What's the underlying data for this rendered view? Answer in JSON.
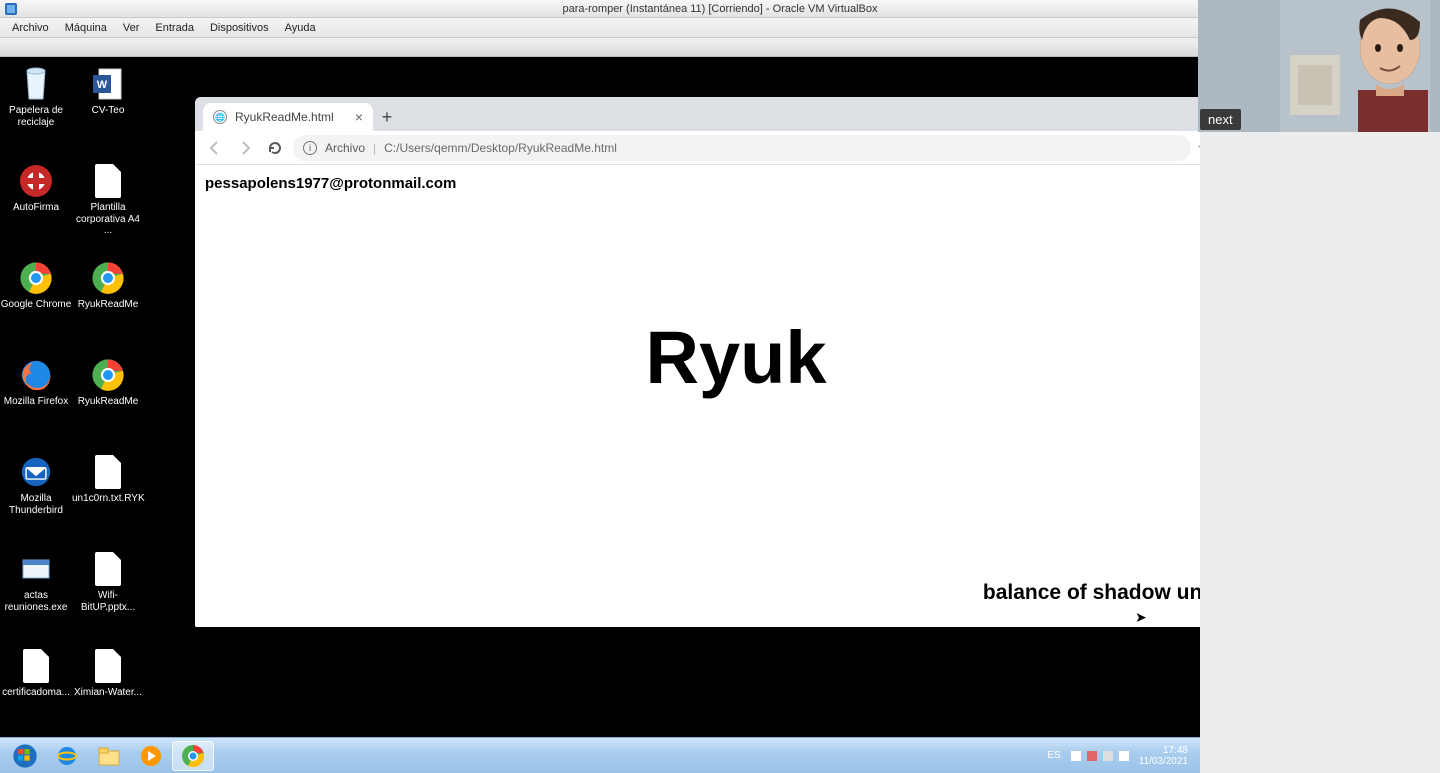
{
  "host_window": {
    "title": "para-romper (Instantánea 11) [Corriendo] - Oracle VM VirtualBox",
    "menu": [
      "Archivo",
      "Máquina",
      "Ver",
      "Entrada",
      "Dispositivos",
      "Ayuda"
    ]
  },
  "desktop_icons": {
    "col1": [
      {
        "name": "recycle-bin",
        "label": "Papelera de reciclaje"
      },
      {
        "name": "autofirma",
        "label": "AutoFirma"
      },
      {
        "name": "google-chrome",
        "label": "Google Chrome"
      },
      {
        "name": "mozilla-firefox",
        "label": "Mozilla Firefox"
      },
      {
        "name": "mozilla-thunderbird",
        "label": "Mozilla Thunderbird"
      },
      {
        "name": "actas-reuniones",
        "label": "actas reuniones.exe"
      },
      {
        "name": "certificadoma",
        "label": "certificadoma..."
      }
    ],
    "col2": [
      {
        "name": "cv-teo",
        "label": "CV-Teo"
      },
      {
        "name": "plantilla-corporativa",
        "label": "Plantilla corporativa A4 ..."
      },
      {
        "name": "ryukreadme-1",
        "label": "RyukReadMe"
      },
      {
        "name": "ryukreadme-2",
        "label": "RyukReadMe"
      },
      {
        "name": "un1c0rn",
        "label": "un1c0rn.txt.RYK"
      },
      {
        "name": "wifi-bitup",
        "label": "Wifi-BitUP.pptx..."
      },
      {
        "name": "ximian-water",
        "label": "Ximian-Water..."
      }
    ]
  },
  "chrome": {
    "tab_title": "RyukReadMe.html",
    "address_label": "Archivo",
    "address_path": "C:/Users/qemm/Desktop/RyukReadMe.html",
    "content": {
      "email": "pessapolens1977@protonmail.com",
      "title": "Ryuk",
      "footer": "balance of shadow universe"
    }
  },
  "taskbar": {
    "lang": "ES",
    "time": "17:48",
    "date": "11/03/2021"
  },
  "overlay": {
    "next_label": "next"
  }
}
